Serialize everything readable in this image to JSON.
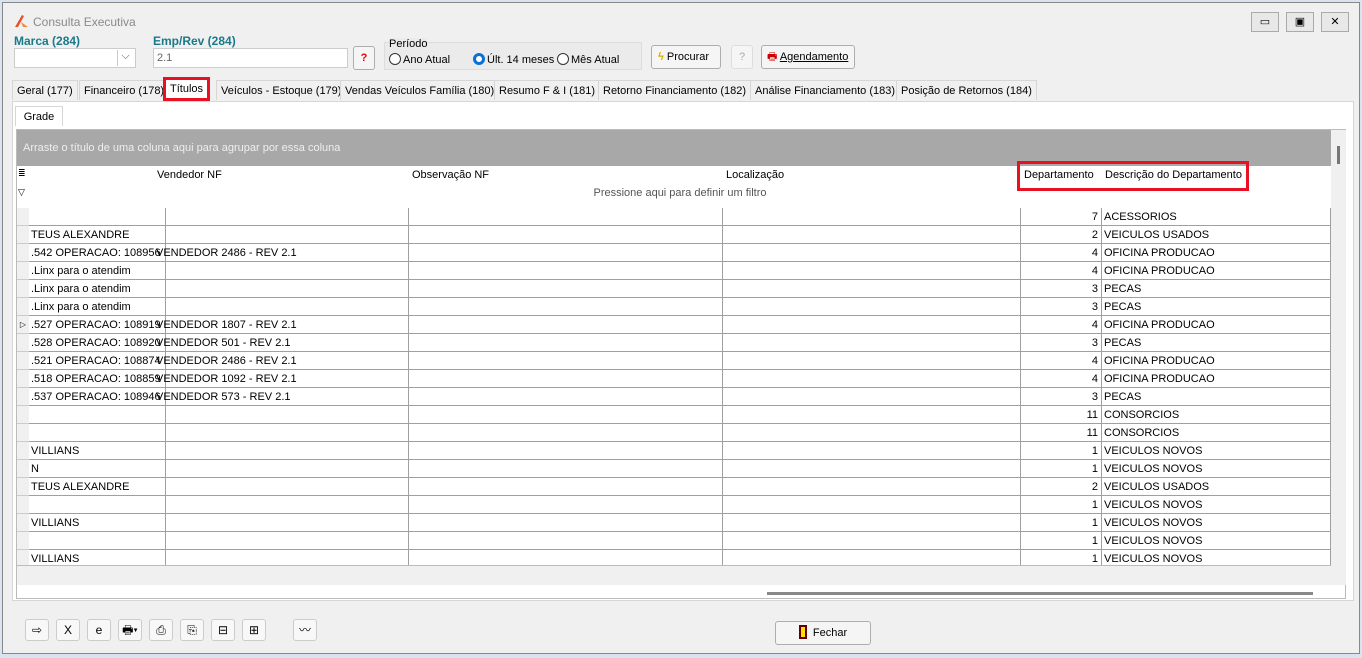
{
  "window": {
    "title": "Consulta Executiva"
  },
  "filters": {
    "marca_label": "Marca (284)",
    "marca_value": "",
    "emp_label": "Emp/Rev (284)",
    "emp_value": "2.1",
    "periodo_label": "Período",
    "periodo_options": [
      "Ano Atual",
      "Últ. 14 meses",
      "Mês Atual"
    ],
    "periodo_selected": "Últ. 14 meses",
    "procurar": "Procurar",
    "agendamento": "Agendamento"
  },
  "tabs": [
    "Geral (177)",
    "Financeiro (178)",
    "Títulos",
    "Veículos - Estoque (179)",
    "Vendas Veículos Família (180)",
    "Resumo F & I (181)",
    "Retorno Financiamento (182)",
    "Análise Financiamento (183)",
    "Posição de Retornos (184)"
  ],
  "active_tab": "Títulos",
  "subtab": "Grade",
  "grid": {
    "group_hint": "Arraste o título de uma coluna aqui para agrupar por essa coluna",
    "filter_hint": "Pressione aqui para definir um filtro",
    "columns": [
      "",
      "Vendedor NF",
      "Observação NF",
      "Localização",
      "Departamento",
      "Descrição do Departamento"
    ],
    "rows": [
      [
        "",
        "",
        "",
        "",
        "7",
        "ACESSORIOS"
      ],
      [
        "TEUS ALEXANDRE",
        "",
        "",
        "",
        "2",
        "VEICULOS USADOS"
      ],
      [
        ".542 OPERACAO: 108956",
        "VENDEDOR 2486 - REV 2.1",
        "",
        "",
        "4",
        "OFICINA PRODUCAO"
      ],
      [
        ".Linx para o atendim",
        "",
        "",
        "",
        "4",
        "OFICINA PRODUCAO"
      ],
      [
        ".Linx para o atendim",
        "",
        "",
        "",
        "3",
        "PECAS"
      ],
      [
        ".Linx para o atendim",
        "",
        "",
        "",
        "3",
        "PECAS"
      ],
      [
        ".527 OPERACAO: 108919",
        "VENDEDOR 1807 - REV 2.1",
        "",
        "",
        "4",
        "OFICINA PRODUCAO"
      ],
      [
        ".528 OPERACAO: 108920",
        "VENDEDOR 501 - REV 2.1",
        "",
        "",
        "3",
        "PECAS"
      ],
      [
        ".521 OPERACAO: 108874",
        "VENDEDOR 2486 - REV 2.1",
        "",
        "",
        "4",
        "OFICINA PRODUCAO"
      ],
      [
        ".518 OPERACAO: 108859",
        "VENDEDOR 1092 - REV 2.1",
        "",
        "",
        "4",
        "OFICINA PRODUCAO"
      ],
      [
        ".537 OPERACAO: 108946",
        "VENDEDOR 573 - REV 2.1",
        "",
        "",
        "3",
        "PECAS"
      ],
      [
        "",
        "",
        "",
        "",
        "11",
        "CONSORCIOS"
      ],
      [
        "",
        "",
        "",
        "",
        "11",
        "CONSORCIOS"
      ],
      [
        "VILLIANS",
        "",
        "",
        "",
        "1",
        "VEICULOS NOVOS"
      ],
      [
        "N",
        "",
        "",
        "",
        "1",
        "VEICULOS NOVOS"
      ],
      [
        "TEUS ALEXANDRE",
        "",
        "",
        "",
        "2",
        "VEICULOS USADOS"
      ],
      [
        "",
        "",
        "",
        "",
        "1",
        "VEICULOS NOVOS"
      ],
      [
        "VILLIANS",
        "",
        "",
        "",
        "1",
        "VEICULOS NOVOS"
      ],
      [
        "",
        "",
        "",
        "",
        "1",
        "VEICULOS NOVOS"
      ],
      [
        "VILLIANS",
        "",
        "",
        "",
        "1",
        "VEICULOS NOVOS"
      ]
    ],
    "current_row": 7
  },
  "footer": {
    "tools": [
      "export-icon",
      "excel-icon",
      "browser-icon",
      "print-icon",
      "print-delete-icon",
      "print-new-icon",
      "collapse-icon",
      "tree-icon",
      "chart-icon"
    ],
    "fechar": "Fechar"
  }
}
